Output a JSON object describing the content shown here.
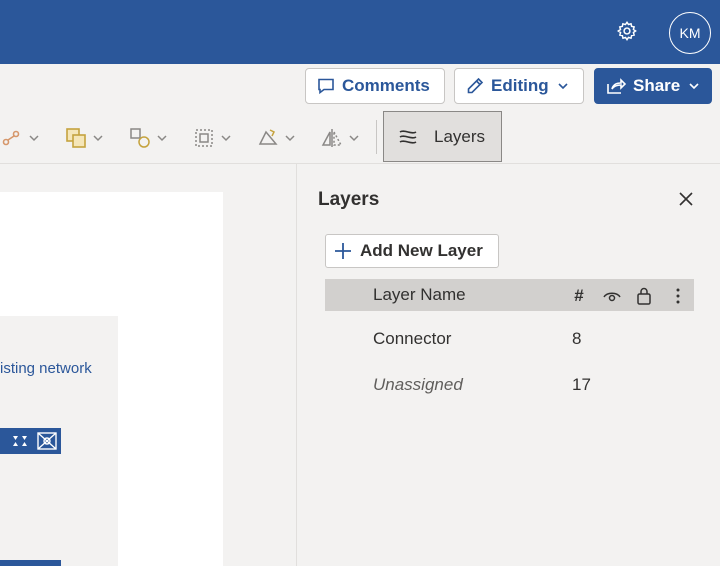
{
  "header": {
    "user_initials": "KM",
    "settings_icon": "gear-icon"
  },
  "actions": {
    "comments_label": "Comments",
    "editing_label": "Editing",
    "share_label": "Share"
  },
  "ribbon": {
    "layers_label": "Layers"
  },
  "canvas": {
    "shape_text": "isting network"
  },
  "layers_pane": {
    "title": "Layers",
    "add_layer_label": "Add New Layer",
    "header": {
      "name_label": "Layer Name",
      "count_symbol": "#"
    },
    "rows": [
      {
        "name": "Connector",
        "count": "8"
      },
      {
        "name": "Unassigned",
        "count": "17"
      }
    ]
  },
  "colors": {
    "brand": "#2b579a",
    "pane_bg": "#f3f2f1",
    "header_row": "#d2d0ce"
  }
}
